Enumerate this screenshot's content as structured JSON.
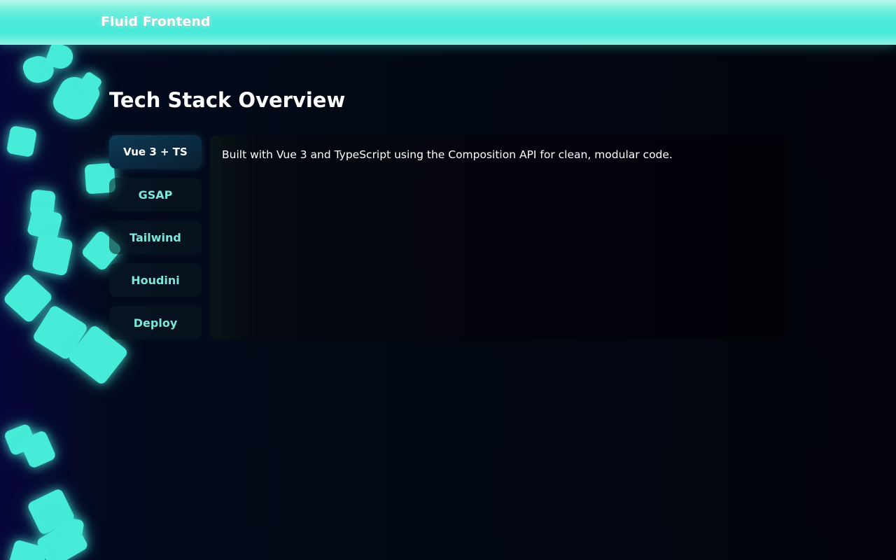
{
  "header": {
    "brand": "Fluid Frontend",
    "accent_color": "#46e9d8"
  },
  "main": {
    "title": "Tech Stack Overview",
    "tabs": [
      {
        "label": "Vue 3 + TS",
        "active": true
      },
      {
        "label": "GSAP",
        "active": false
      },
      {
        "label": "Tailwind",
        "active": false
      },
      {
        "label": "Houdini",
        "active": false
      },
      {
        "label": "Deploy",
        "active": false
      }
    ],
    "panel": {
      "text": "Built with Vue 3 and TypeScript using the Composition API for clean, modular code."
    }
  }
}
